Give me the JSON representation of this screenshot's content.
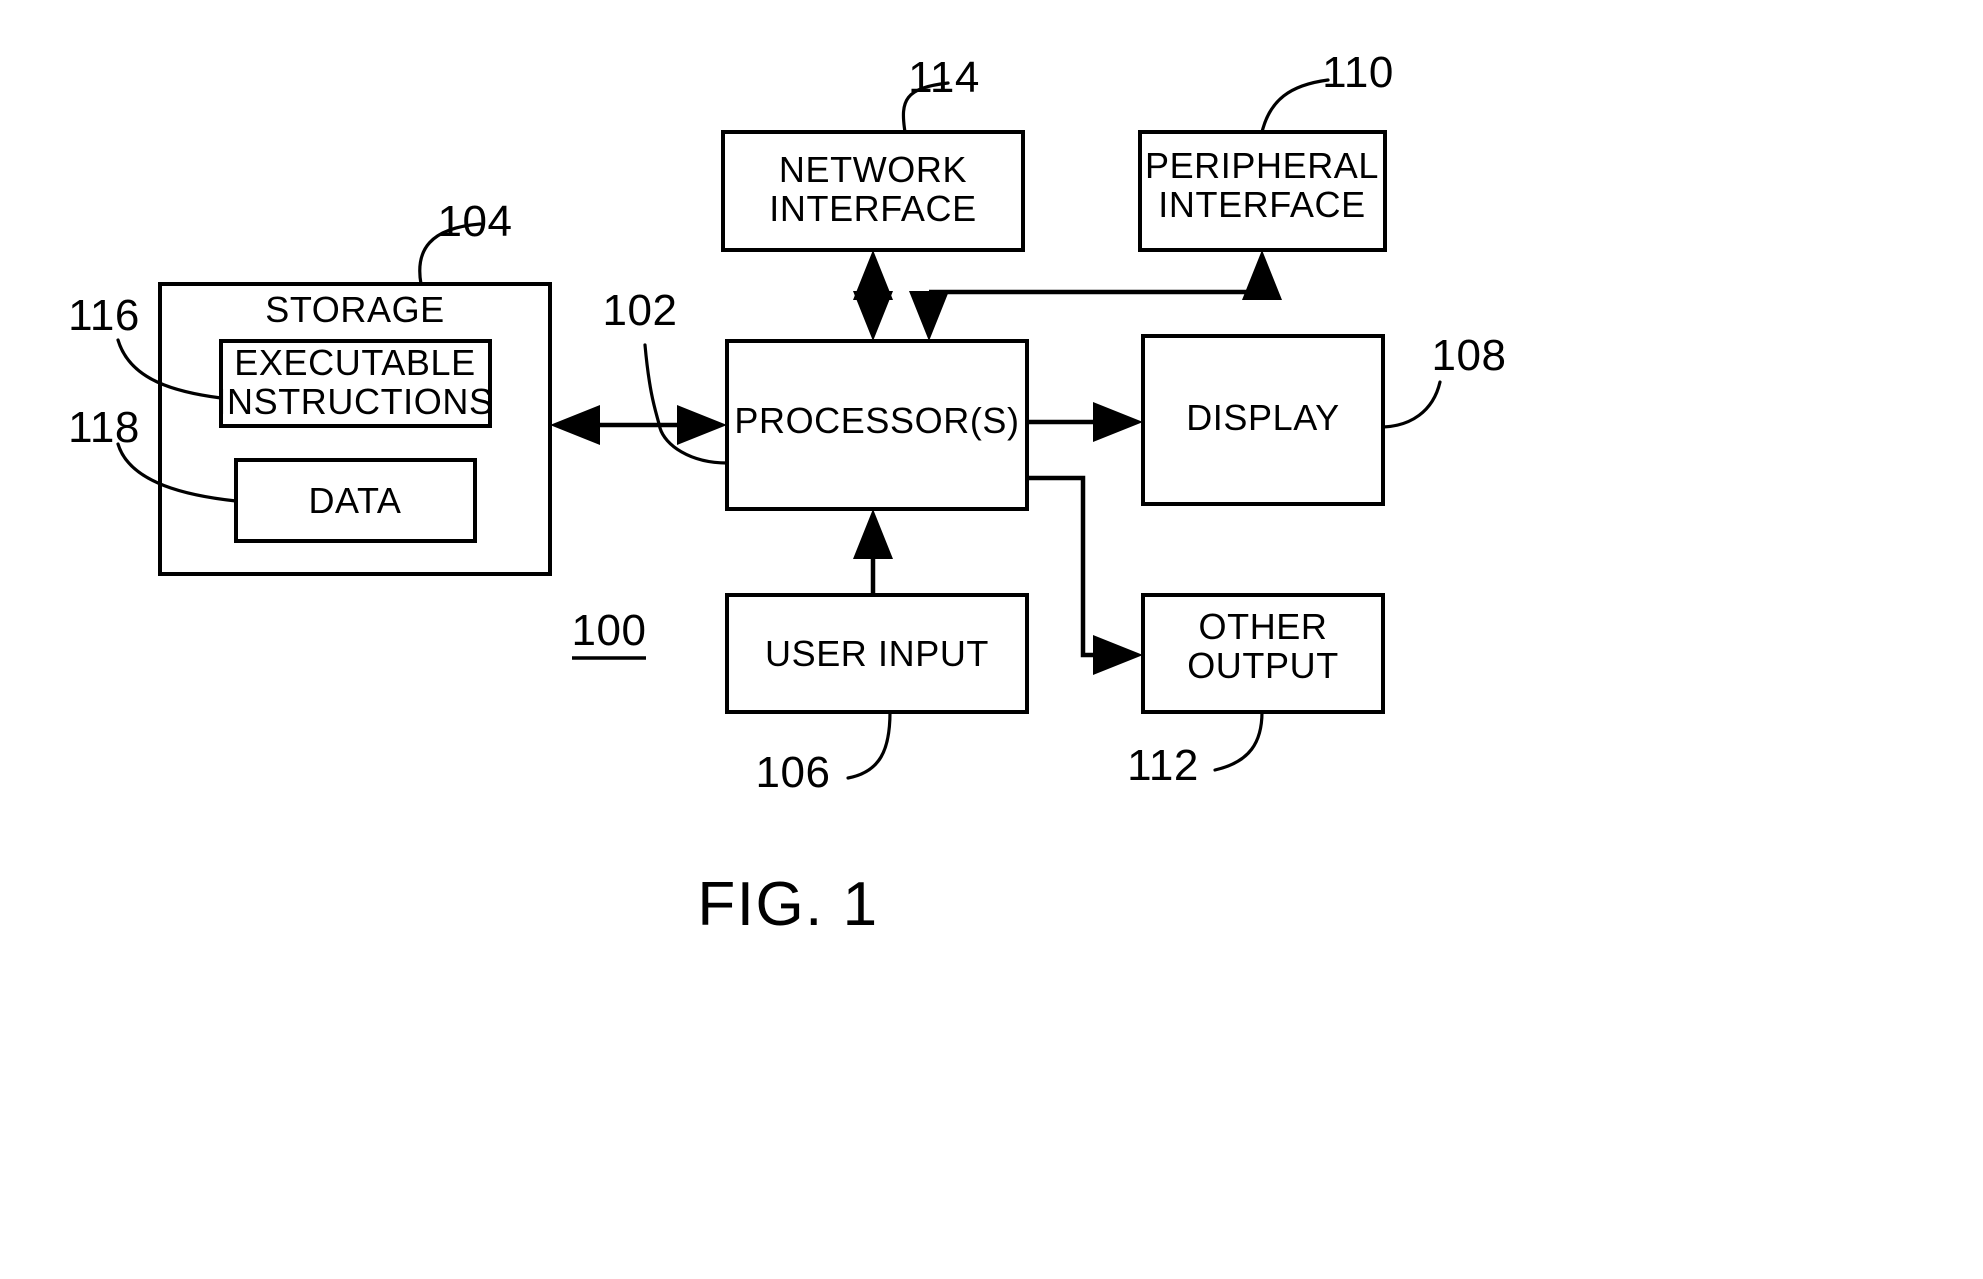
{
  "figure": {
    "caption": "FIG. 1",
    "system_ref": "100"
  },
  "blocks": [
    {
      "id": "storage",
      "lines": [
        "STORAGE"
      ],
      "ref": "104"
    },
    {
      "id": "executable_instructions",
      "lines": [
        "EXECUTABLE",
        "INSTRUCTIONS"
      ],
      "ref": "116"
    },
    {
      "id": "data",
      "lines": [
        "DATA"
      ],
      "ref": "118"
    },
    {
      "id": "network_interface",
      "lines": [
        "NETWORK",
        "INTERFACE"
      ],
      "ref": "114"
    },
    {
      "id": "peripheral_interface",
      "lines": [
        "PERIPHERAL",
        "INTERFACE"
      ],
      "ref": "110"
    },
    {
      "id": "processors",
      "lines": [
        "PROCESSOR(S)"
      ],
      "ref": "102"
    },
    {
      "id": "display",
      "lines": [
        "DISPLAY"
      ],
      "ref": "108"
    },
    {
      "id": "user_input",
      "lines": [
        "USER INPUT"
      ],
      "ref": "106"
    },
    {
      "id": "other_output",
      "lines": [
        "OTHER",
        "OUTPUT"
      ],
      "ref": "112"
    }
  ],
  "labels": {
    "storage": "STORAGE",
    "executable_instructions_line1": "EXECUTABLE",
    "executable_instructions_line2": "INSTRUCTIONS",
    "data": "DATA",
    "network_interface_line1": "NETWORK",
    "network_interface_line2": "INTERFACE",
    "peripheral_interface_line1": "PERIPHERAL",
    "peripheral_interface_line2": "INTERFACE",
    "processors": "PROCESSOR(S)",
    "display": "DISPLAY",
    "user_input": "USER INPUT",
    "other_output_line1": "OTHER",
    "other_output_line2": "OUTPUT"
  },
  "reference_numerals": {
    "system": "100",
    "processors": "102",
    "storage": "104",
    "user_input": "106",
    "display": "108",
    "peripheral_interface": "110",
    "other_output": "112",
    "network_interface": "114",
    "executable_instructions": "116",
    "data": "118"
  },
  "colors": {
    "line": "#000000",
    "background": "#ffffff",
    "text": "#000000"
  },
  "connections": [
    {
      "from": "storage",
      "to": "processors",
      "style": "bidirectional"
    },
    {
      "from": "network_interface",
      "to": "processors",
      "style": "bidirectional"
    },
    {
      "from": "processors",
      "to": "peripheral_interface",
      "style": "bidirectional-routed"
    },
    {
      "from": "processors",
      "to": "display",
      "style": "unidirectional"
    },
    {
      "from": "user_input",
      "to": "processors",
      "style": "unidirectional"
    },
    {
      "from": "processors",
      "to": "other_output",
      "style": "unidirectional-routed"
    }
  ]
}
